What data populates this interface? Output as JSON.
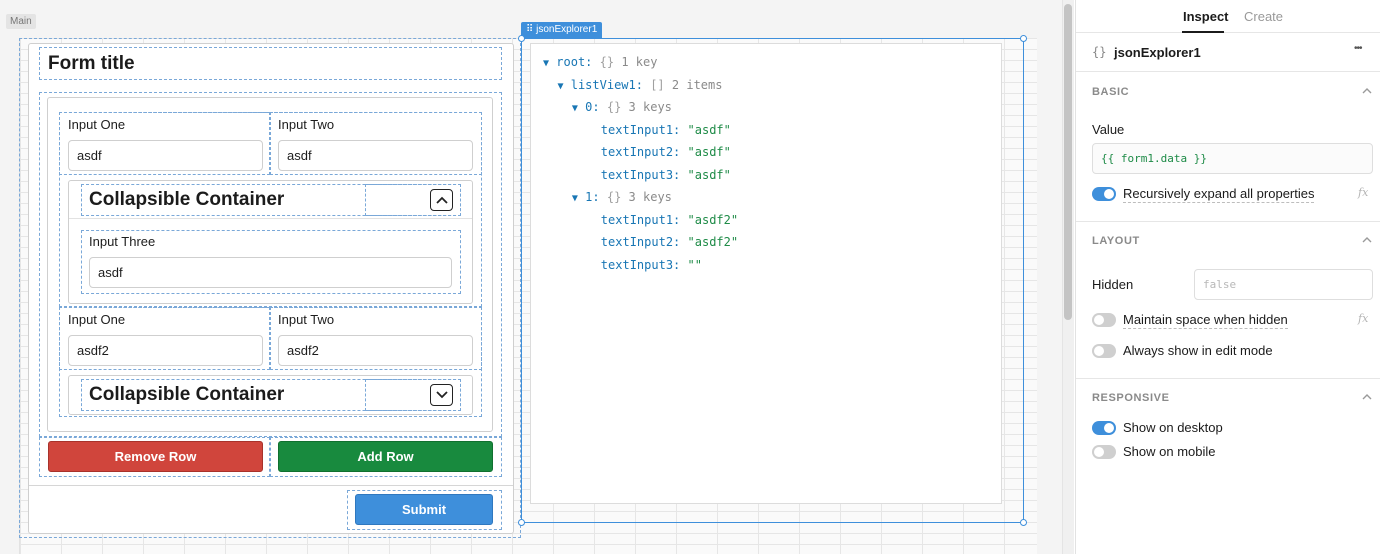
{
  "canvas": {
    "frame_label": "Main",
    "form": {
      "title": "Form title",
      "rows": [
        {
          "input_one_label": "Input One",
          "input_one_value": "asdf",
          "input_two_label": "Input Two",
          "input_two_value": "asdf",
          "collapsible_title": "Collapsible Container",
          "collapsible_expanded": true,
          "input_three_label": "Input Three",
          "input_three_value": "asdf"
        },
        {
          "input_one_label": "Input One",
          "input_one_value": "asdf2",
          "input_two_label": "Input Two",
          "input_two_value": "asdf2",
          "collapsible_title": "Collapsible Container",
          "collapsible_expanded": false
        }
      ],
      "remove_row_label": "Remove Row",
      "add_row_label": "Add Row",
      "submit_label": "Submit"
    },
    "json_explorer": {
      "selected_tag": "jsonExplorer1",
      "lines": [
        {
          "key": "root:",
          "type": "{}",
          "meta": "1 key"
        },
        {
          "key": "listView1:",
          "type": "[]",
          "meta": "2 items"
        },
        {
          "key": "0:",
          "type": "{}",
          "meta": "3 keys"
        },
        {
          "key": "textInput1:",
          "value": "\"asdf\""
        },
        {
          "key": "textInput2:",
          "value": "\"asdf\""
        },
        {
          "key": "textInput3:",
          "value": "\"asdf\""
        },
        {
          "key": "1:",
          "type": "{}",
          "meta": "3 keys"
        },
        {
          "key": "textInput1:",
          "value": "\"asdf2\""
        },
        {
          "key": "textInput2:",
          "value": "\"asdf2\""
        },
        {
          "key": "textInput3:",
          "value": "\"\""
        }
      ]
    }
  },
  "inspector": {
    "tabs": {
      "inspect": "Inspect",
      "create": "Create"
    },
    "component_name": "jsonExplorer1",
    "component_icon": "{}",
    "more_icon": "•••",
    "sections": {
      "basic": "BASIC",
      "layout": "LAYOUT",
      "responsive": "RESPONSIVE"
    },
    "value_label": "Value",
    "value_expression": "{{ form1.data }}",
    "recursive_expand_label": "Recursively expand all properties",
    "recursive_expand_on": true,
    "hidden_label": "Hidden",
    "hidden_placeholder": "false",
    "maintain_space_label": "Maintain space when hidden",
    "maintain_space_on": false,
    "always_show_label": "Always show in edit mode",
    "always_show_on": false,
    "show_desktop_label": "Show on desktop",
    "show_desktop_on": true,
    "show_mobile_label": "Show on mobile",
    "show_mobile_on": false,
    "fx_label": "fx"
  },
  "colors": {
    "accent": "#3e8fdb",
    "remove": "#d0453c",
    "add": "#188a3e",
    "json_key": "#1876b4",
    "json_string": "#1e8b47"
  }
}
